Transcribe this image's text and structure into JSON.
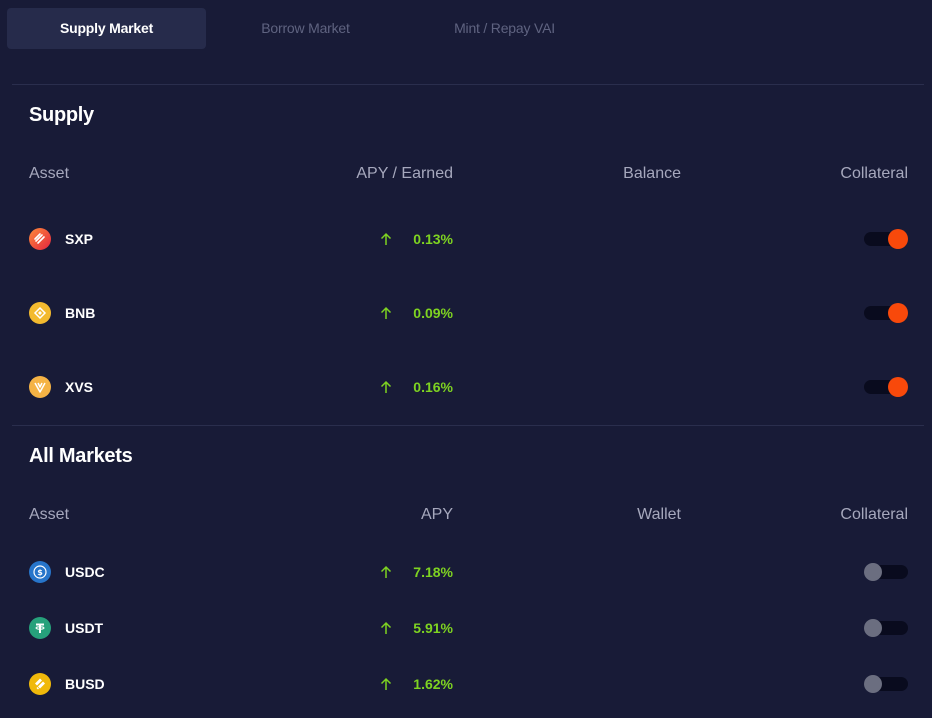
{
  "tabs": [
    {
      "label": "Supply Market",
      "active": true
    },
    {
      "label": "Borrow Market",
      "active": false
    },
    {
      "label": "Mint / Repay VAI",
      "active": false
    }
  ],
  "supply": {
    "title": "Supply",
    "headers": {
      "asset": "Asset",
      "apy": "APY / Earned",
      "balance": "Balance",
      "collateral": "Collateral"
    },
    "rows": [
      {
        "asset": "SXP",
        "icon": "sxp-icon",
        "apy": "0.13%",
        "collateral": true
      },
      {
        "asset": "BNB",
        "icon": "bnb-icon",
        "apy": "0.09%",
        "collateral": true
      },
      {
        "asset": "XVS",
        "icon": "xvs-icon",
        "apy": "0.16%",
        "collateral": true
      }
    ]
  },
  "all_markets": {
    "title": "All Markets",
    "headers": {
      "asset": "Asset",
      "apy": "APY",
      "wallet": "Wallet",
      "collateral": "Collateral"
    },
    "rows": [
      {
        "asset": "USDC",
        "icon": "usdc-icon",
        "apy": "7.18%",
        "collateral": false
      },
      {
        "asset": "USDT",
        "icon": "usdt-icon",
        "apy": "5.91%",
        "collateral": false
      },
      {
        "asset": "BUSD",
        "icon": "busd-icon",
        "apy": "1.62%",
        "collateral": false
      }
    ]
  },
  "colors": {
    "background": "#181b37",
    "apy_positive": "#7ed321",
    "toggle_on": "#f8490b",
    "toggle_off": "#6b6e80"
  }
}
